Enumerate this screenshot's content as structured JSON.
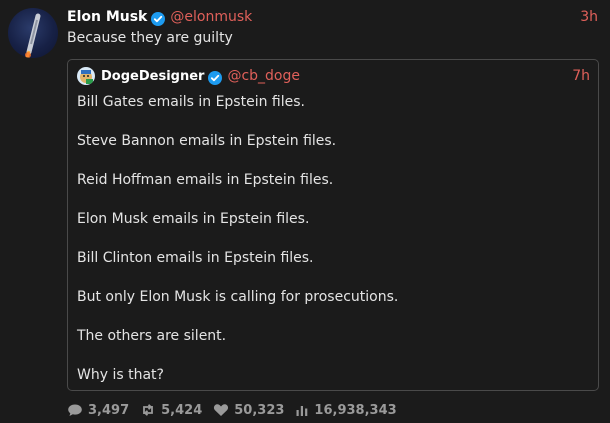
{
  "colors": {
    "background": "#1b1b1b",
    "accent": "#e0605a",
    "verified": "#1d9bf0",
    "muted": "#9a9a9a",
    "border": "#4a4a4a"
  },
  "post": {
    "author_name": "Elon Musk",
    "handle": "@elonmusk",
    "time": "3h",
    "text": "Because they are guilty",
    "avatar_icon": "rocket-avatar",
    "verified_icon": "verified-badge-icon"
  },
  "quote": {
    "author_name": "DogeDesigner",
    "handle": "@cb_doge",
    "time": "7h",
    "avatar_icon": "doge-avatar",
    "verified_icon": "verified-badge-icon",
    "lines": [
      "Bill Gates emails in Epstein files.",
      "Steve Bannon emails in Epstein files.",
      "Reid Hoffman emails in Epstein files.",
      "Elon Musk emails in Epstein files.",
      "Bill Clinton emails in Epstein files.",
      "But only Elon Musk is calling for prosecutions.",
      "The others are silent.",
      "Why is that?"
    ]
  },
  "stats": {
    "replies": "3,497",
    "reposts": "5,424",
    "likes": "50,323",
    "views": "16,938,343",
    "icons": [
      "reply-icon",
      "repost-icon",
      "like-icon",
      "views-icon"
    ]
  }
}
